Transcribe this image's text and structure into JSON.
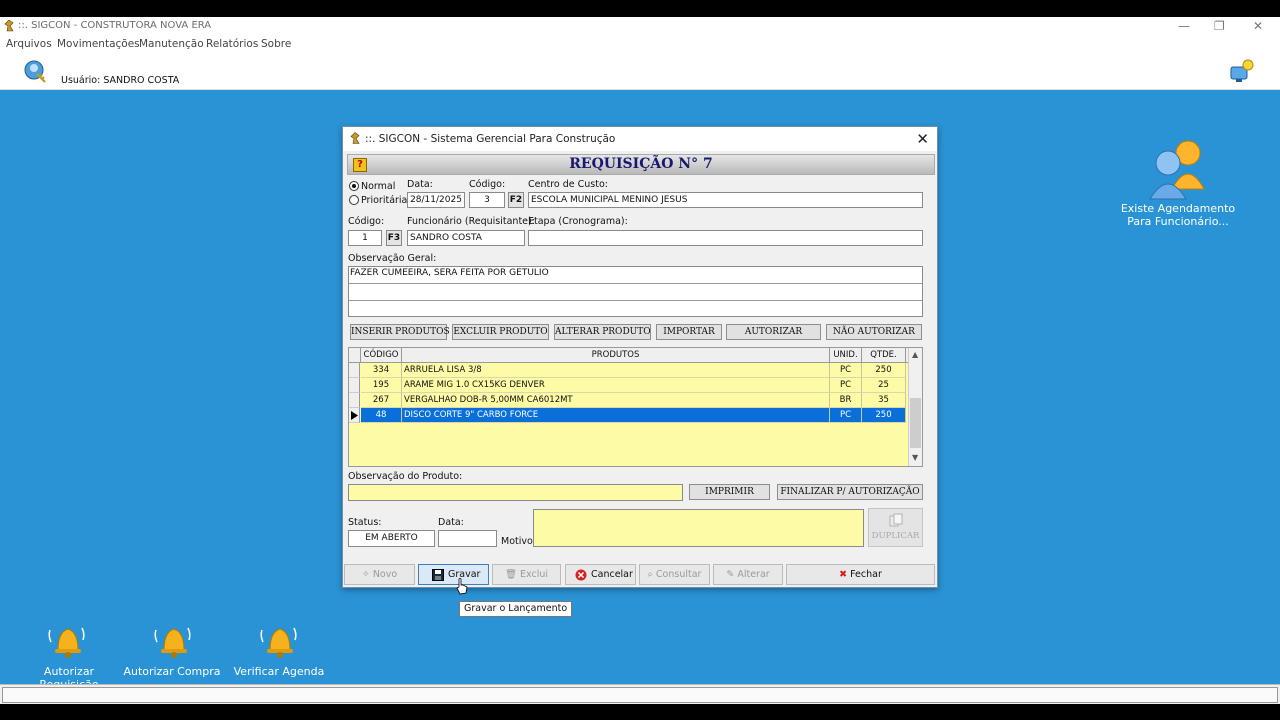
{
  "app": {
    "title": "::. SIGCON - CONSTRUTORA NOVA ERA",
    "menu": [
      "Arquivos",
      "Movimentações",
      "Manutenção",
      "Relatórios",
      "Sobre"
    ],
    "user_label": "Usuário: SANDRO COSTA",
    "notification_label_line1": "Existe Agendamento",
    "notification_label_line2": "Para Funcionário...",
    "desktop_icons": [
      "Autorizar Requisição",
      "Autorizar Compra",
      "Verificar Agenda"
    ]
  },
  "dialog": {
    "title": "::. SIGCON - Sistema Gerencial Para Construção",
    "banner": "REQUISIÇÃO N° 7",
    "help": "?",
    "priority": {
      "normal_label": "Normal",
      "prioritaria_label": "Prioritária",
      "selected": "Normal"
    },
    "data_label": "Data:",
    "data_value": "28/11/2025",
    "codigo_label": "Código:",
    "codigo_value": "3",
    "f2": "F2",
    "centro_label": "Centro de Custo:",
    "centro_value": "ESCOLA MUNICIPAL MENINO JESUS",
    "codigo2_label": "Código:",
    "codigo2_value": "1",
    "f3": "F3",
    "funcionario_label": "Funcionário (Requisitante):",
    "funcionario_value": "SANDRO COSTA",
    "etapa_label": "Etapa (Cronograma):",
    "etapa_value": "",
    "obs_label": "Observação Geral:",
    "obs_lines": [
      "FAZER CUMEEIRA, SERA FEITA POR GETULIO",
      "",
      ""
    ],
    "actions": [
      "INSERIR PRODUTOS",
      "EXCLUIR PRODUTO",
      "ALTERAR PRODUTO",
      "IMPORTAR",
      "AUTORIZAR",
      "NÃO AUTORIZAR"
    ],
    "grid": {
      "columns": [
        "CÓDIGO",
        "PRODUTOS",
        "UNID.",
        "QTDE."
      ],
      "rows": [
        {
          "codigo": "334",
          "produto": "ARRUELA LISA 3/8",
          "unid": "PC",
          "qtde": "250"
        },
        {
          "codigo": "195",
          "produto": "ARAME MIG 1.0 CX15KG DENVER",
          "unid": "PC",
          "qtde": "25"
        },
        {
          "codigo": "267",
          "produto": "VERGALHAO DOB-R 5,00MM CA6012MT",
          "unid": "BR",
          "qtde": "35"
        },
        {
          "codigo": "48",
          "produto": "DISCO CORTE 9\" CARBO FORCE",
          "unid": "PC",
          "qtde": "250"
        }
      ],
      "selected_row": 3
    },
    "obs_produto_label": "Observação do Produto:",
    "obs_produto_value": "",
    "imprimir": "IMPRIMIR",
    "finalizar": "FINALIZAR P/ AUTORIZAÇÃO",
    "status_label": "Status:",
    "status_value": "EM ABERTO",
    "data2_label": "Data:",
    "data2_value": "",
    "motivo_label": "Motivo:",
    "motivo_value": "",
    "duplicar": "DUPLICAR",
    "bottom": {
      "novo": "Novo",
      "gravar": "Gravar",
      "exclui": "Exclui",
      "cancelar": "Cancelar",
      "consultar": "Consultar",
      "alterar": "Alterar",
      "fechar": "Fechar"
    },
    "tooltip": "Gravar o Lançamento"
  }
}
